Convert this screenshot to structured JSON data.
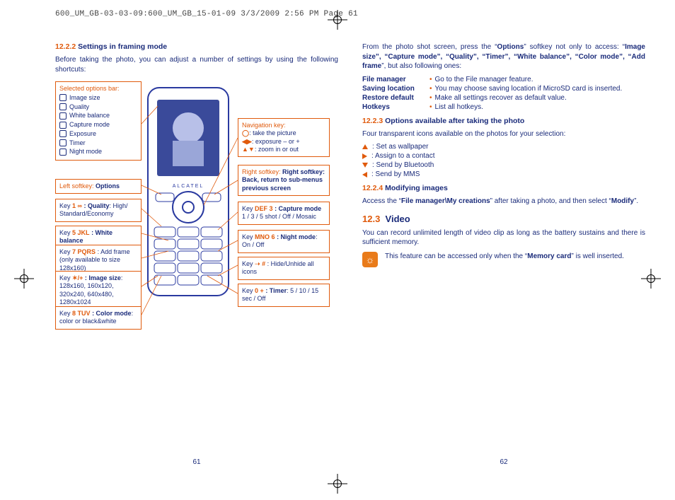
{
  "header": "600_UM_GB-03-03-09:600_UM_GB_15-01-09  3/3/2009  2:56 PM  Page 61",
  "left": {
    "sec1_num": "12.2.2",
    "sec1_title": "Settings in framing mode",
    "intro": "Before taking the photo, you can adjust a number of settings by using the following shortcuts:",
    "options_bar_title": "Selected options bar:",
    "options_bar": [
      "Image size",
      "Quality",
      "White balance",
      "Capture mode",
      "Exposure",
      "Timer",
      "Night mode"
    ],
    "left_softkey_title": "Left softkey:",
    "left_softkey_value": "Options",
    "k1": {
      "pre": "Key",
      "glyph": "1 ∞",
      "label": ": Quality",
      "val": ": High/ Standard/Economy"
    },
    "k5": {
      "pre": "Key",
      "glyph": "5 JKL",
      "label": ": White balance",
      "val": ""
    },
    "k7": {
      "pre": "Key",
      "glyph": "7 PQRS",
      "label": ": Add frame (only available to size 128x160)",
      "val": ""
    },
    "kstar": {
      "pre": "Key",
      "glyph": "✶/+",
      "label": ": Image size",
      "val": ": 128x160, 160x120, 320x240, 640x480, 1280x1024"
    },
    "k8": {
      "pre": "Key",
      "glyph": "8 TUV",
      "label": ": Color mode",
      "val": ": color or black&white"
    },
    "nav_title": "Navigation key:",
    "nav_items": {
      "center": ": take the picture",
      "lr": ": exposure – or +",
      "ud": ": zoom in or out"
    },
    "right_softkey": "Right softkey: Back, return to sub-menus previous screen",
    "k3": {
      "pre": "Key",
      "glyph": "DEF 3",
      "label": ": Capture mode",
      "val": " 1 / 3 / 5 shot / Off / Mosaic"
    },
    "k6": {
      "pre": "Key",
      "glyph": "MNO 6",
      "label": ": Night mode",
      "val": ": On / Off"
    },
    "khash": {
      "pre": "Key",
      "glyph": "➝ #",
      "label": ": Hide/Unhide all icons",
      "val": ""
    },
    "k0": {
      "pre": "Key",
      "glyph": "0 +",
      "label": ": Timer",
      "val": ": 5 / 10 / 15 sec / Off"
    },
    "phone_brand": "A L C A T E L",
    "page_num": "61"
  },
  "right": {
    "intro_parts": {
      "a": "From the photo shot screen, press the “",
      "b": "Options",
      "c": "” softkey not only to access: “",
      "list": "Image size”, “Capture mode”, “Quality”, “Timer”, “White balance”, “Color mode”, “Add frame",
      "d": "”, but also following ones:"
    },
    "defs": [
      {
        "term": "File manager",
        "body": "Go to the File manager feature."
      },
      {
        "term": "Saving location",
        "body": "You may choose saving location if MicroSD card is inserted."
      },
      {
        "term": "Restore default",
        "body": "Make all settings recover as default value."
      },
      {
        "term": "Hotkeys",
        "body": "List all hotkeys."
      }
    ],
    "sec3_num": "12.2.3",
    "sec3_title": "Options available after taking the photo",
    "sec3_intro": "Four transparent icons available on the photos for your selection:",
    "icons": [
      ": Set as wallpaper",
      ": Assign to a contact",
      ": Send by Bluetooth",
      ": Send by MMS"
    ],
    "sec4_num": "12.2.4",
    "sec4_title": "Modifying images",
    "sec4_body_a": "Access the “",
    "sec4_body_b": "File manager\\My creations",
    "sec4_body_c": "” after taking a photo, and then select “",
    "sec4_body_d": "Modify",
    "sec4_body_e": "”.",
    "video_num": "12.3",
    "video_title": "Video",
    "video_body": "You can record unlimited length of video clip as long as the battery sustains and there is sufficient memory.",
    "note_a": "This feature can be accessed only when the “",
    "note_b": "Memory card",
    "note_c": "” is well inserted.",
    "page_num": "62"
  }
}
